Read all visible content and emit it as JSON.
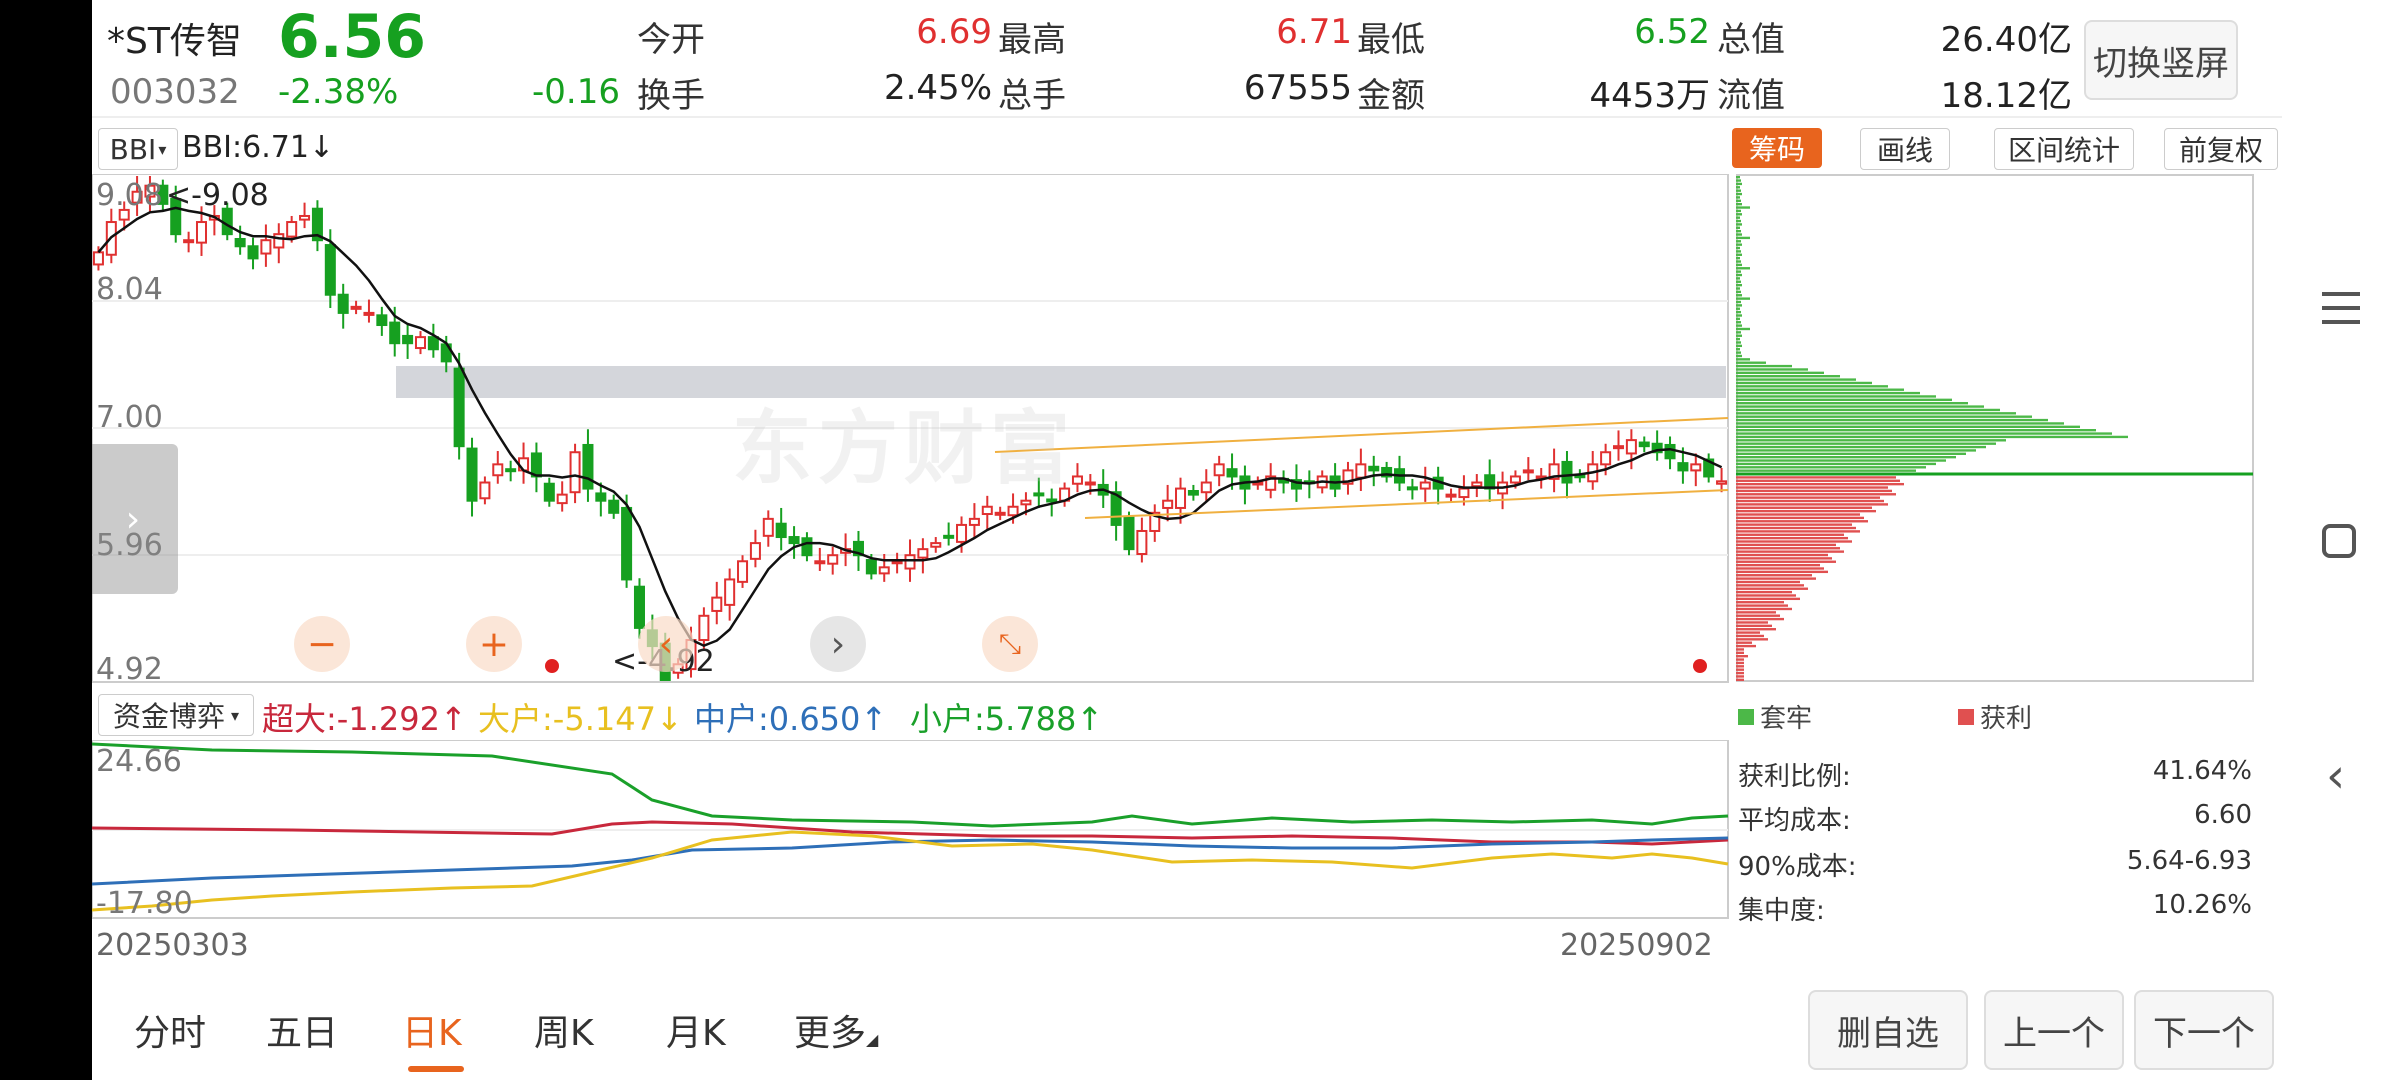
{
  "header": {
    "name": "*ST传智",
    "price": "6.56",
    "code": "003032",
    "change_pct": "-2.38%",
    "change": "-0.16",
    "switch_label": "切换竖屏",
    "stats": [
      {
        "label": "今开",
        "value": "6.69",
        "color": "#e03030"
      },
      {
        "label": "最高",
        "value": "6.71",
        "color": "#e03030"
      },
      {
        "label": "最低",
        "value": "6.52",
        "color": "#16a020"
      },
      {
        "label": "总值",
        "value": "26.40亿",
        "color": "#222222"
      },
      {
        "label": "换手",
        "value": "2.45%",
        "color": "#222222"
      },
      {
        "label": "总手",
        "value": "67555",
        "color": "#222222"
      },
      {
        "label": "金额",
        "value": "4453万",
        "color": "#222222"
      },
      {
        "label": "流值",
        "value": "18.12亿",
        "color": "#222222"
      }
    ]
  },
  "indicator": {
    "selector": "BBI",
    "text": "BBI:6.71↓"
  },
  "tools": {
    "chips": "筹码",
    "draw": "画线",
    "range": "区间统计",
    "adjust": "前复权"
  },
  "price_axis": {
    "labels": [
      "9.08",
      "8.04",
      "7.00",
      "5.96",
      "4.92"
    ],
    "high_note": "<-9.08",
    "low_note": "<-4.92"
  },
  "zoom": {
    "minus": "−",
    "plus": "+",
    "prev": "‹",
    "next": "›"
  },
  "watermark": "东方财富",
  "fund": {
    "selector": "资金博弈",
    "items": [
      {
        "text": "超大:-1.292↑",
        "color": "#c8283c"
      },
      {
        "text": "大户:-5.147↓",
        "color": "#e8c020"
      },
      {
        "text": "中户:0.650↑",
        "color": "#2e6fb8"
      },
      {
        "text": "小户:5.788↑",
        "color": "#1aa02a"
      }
    ],
    "axis_top": "24.66",
    "axis_bottom": "-17.80"
  },
  "dates": {
    "start": "20250303",
    "end": "20250902"
  },
  "chip_panel": {
    "legend_trapped": "套牢",
    "legend_profit": "获利",
    "stats": [
      {
        "label": "获利比例:",
        "value": "41.64%"
      },
      {
        "label": "平均成本:",
        "value": "6.60"
      },
      {
        "label": "90%成本:",
        "value": "5.64-6.93"
      },
      {
        "label": "集中度:",
        "value": "10.26%"
      }
    ]
  },
  "tabs": [
    {
      "label": "分时",
      "active": false
    },
    {
      "label": "五日",
      "active": false
    },
    {
      "label": "日K",
      "active": true
    },
    {
      "label": "周K",
      "active": false
    },
    {
      "label": "月K",
      "active": false
    },
    {
      "label": "更多",
      "active": false
    }
  ],
  "actions": {
    "remove": "删自选",
    "prev": "上一个",
    "next": "下一个"
  },
  "colors": {
    "up": "#e03030",
    "down": "#16a020",
    "accent": "#e8641e",
    "ma": "#111111"
  },
  "chart_data": {
    "type": "candlestick",
    "x_range": [
      "20250303",
      "20250902"
    ],
    "ylim": [
      4.92,
      9.08
    ],
    "closes": [
      8.45,
      8.7,
      8.8,
      8.95,
      9.0,
      8.85,
      8.6,
      8.55,
      8.7,
      8.75,
      8.6,
      8.5,
      8.4,
      8.55,
      8.6,
      8.7,
      8.75,
      8.55,
      8.1,
      7.95,
      8.0,
      7.95,
      7.85,
      7.7,
      7.7,
      7.75,
      7.65,
      7.55,
      6.85,
      6.4,
      6.55,
      6.7,
      6.65,
      6.75,
      6.6,
      6.4,
      6.45,
      6.8,
      6.5,
      6.4,
      6.3,
      5.75,
      5.35,
      5.2,
      4.92,
      5.05,
      5.25,
      5.45,
      5.6,
      5.75,
      5.9,
      6.05,
      6.25,
      6.1,
      6.05,
      5.95,
      5.9,
      5.95,
      6.0,
      5.95,
      5.8,
      5.85,
      5.9,
      5.95,
      6.0,
      6.05,
      6.1,
      6.2,
      6.25,
      6.35,
      6.3,
      6.35,
      6.4,
      6.45,
      6.4,
      6.5,
      6.6,
      6.55,
      6.45,
      6.2,
      6.0,
      6.15,
      6.3,
      6.4,
      6.5,
      6.45,
      6.55,
      6.7,
      6.6,
      6.5,
      6.55,
      6.6,
      6.55,
      6.5,
      6.55,
      6.6,
      6.5,
      6.65,
      6.7,
      6.65,
      6.6,
      6.55,
      6.5,
      6.55,
      6.5,
      6.45,
      6.5,
      6.55,
      6.5,
      6.55,
      6.6,
      6.65,
      6.6,
      6.7,
      6.55,
      6.6,
      6.7,
      6.8,
      6.85,
      6.9,
      6.85,
      6.8,
      6.75,
      6.65,
      6.7,
      6.6,
      6.56
    ]
  }
}
